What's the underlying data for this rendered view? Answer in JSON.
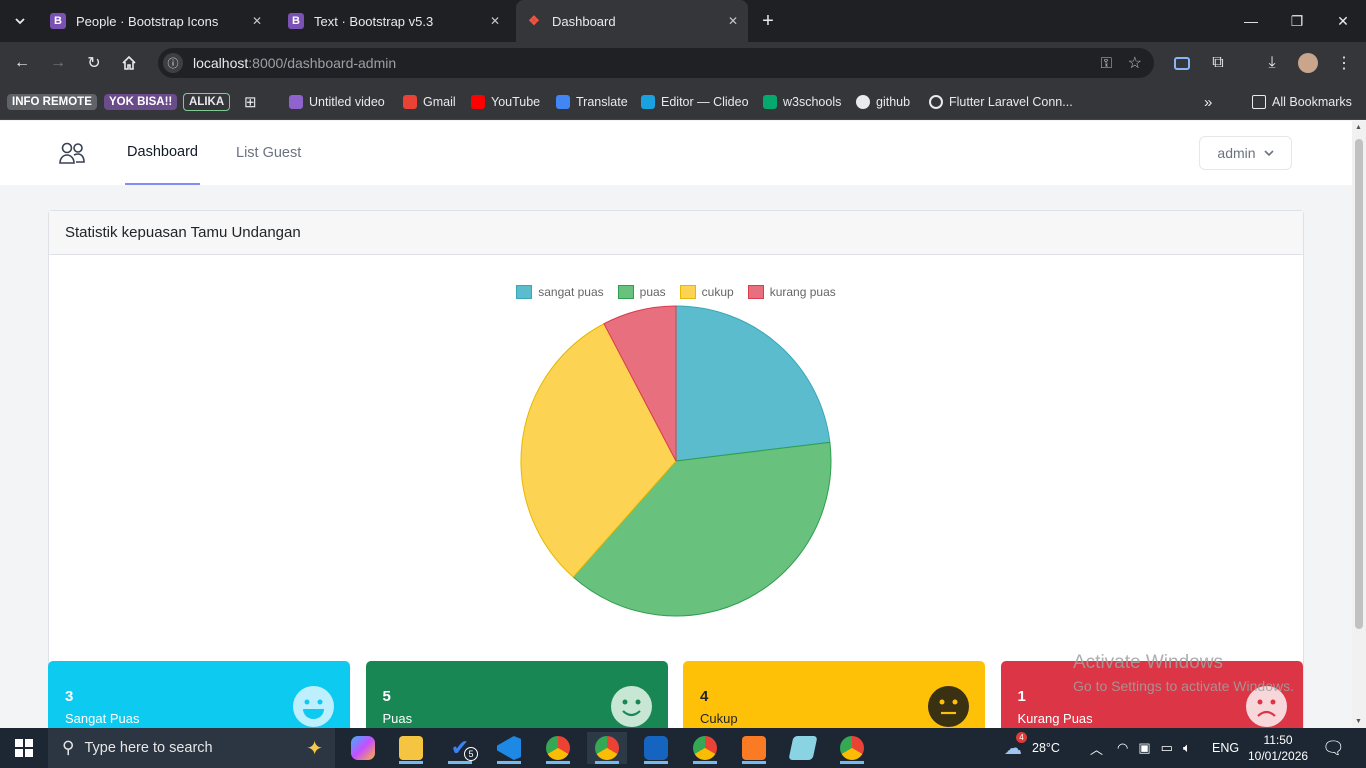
{
  "browser": {
    "tabs": [
      {
        "title": "People · Bootstrap Icons",
        "icon": "bootstrap-icon"
      },
      {
        "title": "Text · Bootstrap v5.3",
        "icon": "bootstrap-icon"
      },
      {
        "title": "Dashboard",
        "icon": "laravel-icon",
        "active": true
      }
    ],
    "url_host": "localhost",
    "url_path": ":8000/dashboard-admin",
    "bookmarks": [
      "INFO REMOTE",
      "YOK BISA!!",
      "ALIKA",
      "Untitled video",
      "Gmail",
      "YouTube",
      "Translate",
      "Editor — Clideo",
      "w3schools",
      "github",
      "Flutter Laravel Conn..."
    ],
    "all_bookmarks": "All Bookmarks"
  },
  "app": {
    "nav": {
      "dashboard": "Dashboard",
      "list_guest": "List Guest",
      "user": "admin"
    },
    "card_title": "Statistik kepuasan Tamu Undangan",
    "chart_data": {
      "type": "pie",
      "title": "",
      "categories": [
        "sangat puas",
        "puas",
        "cukup",
        "kurang puas"
      ],
      "values": [
        3,
        5,
        4,
        1
      ],
      "colors": [
        "#5bbccd",
        "#68c17c",
        "#fdd353",
        "#e8707e"
      ],
      "borders": [
        "#3aa6b9",
        "#2e9e52",
        "#e6b800",
        "#d93b4f"
      ],
      "legend_position": "top"
    },
    "stats": [
      {
        "value": "3",
        "label": "Sangat Puas",
        "color": "#0dcaf0",
        "face": "grin"
      },
      {
        "value": "5",
        "label": "Puas",
        "color": "#198754",
        "face": "smile"
      },
      {
        "value": "4",
        "label": "Cukup",
        "color": "#ffc107",
        "face": "neutral"
      },
      {
        "value": "1",
        "label": "Kurang Puas",
        "color": "#dc3545",
        "face": "frown"
      }
    ]
  },
  "watermark": {
    "line1": "Activate Windows",
    "line2": "Go to Settings to activate Windows."
  },
  "taskbar": {
    "search_placeholder": "Type here to search",
    "weather": "28°C",
    "weather_badge": "4",
    "lang": "ENG",
    "time": "11:50",
    "date": "10/01/2026",
    "vscode_badge": "5"
  }
}
